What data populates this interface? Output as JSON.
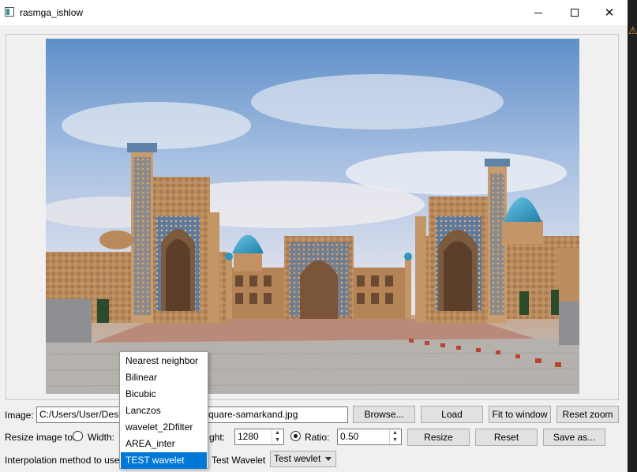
{
  "window": {
    "title": "rasmga_ishlow",
    "minimize_symbol": "—",
    "maximize_symbol": "☐",
    "close_symbol": "✕"
  },
  "image_row": {
    "label": "Image:",
    "path_left": "C:/Users/User/Deskto",
    "path_right": "square-samarkand.jpg",
    "browse_label": "Browse...",
    "load_label": "Load",
    "fit_label": "Fit to window",
    "reset_zoom_label": "Reset zoom"
  },
  "resize_row": {
    "label": "Resize image to:",
    "width_label": "Width:",
    "height_label_visible": "ght:",
    "height_value": "1280",
    "ratio_label": "Ratio:",
    "ratio_value": "0.50",
    "resize_label": "Resize",
    "reset_label": "Reset",
    "save_label": "Save as..."
  },
  "interp_row": {
    "label": "Interpolation method to use:",
    "test_wavelet_label": "Test Wavelet",
    "test_wavelet_combo": "Test wevlet"
  },
  "dropdown": {
    "options": [
      "Nearest neighbor",
      "Bilinear",
      "Bicubic",
      "Lanczos",
      "wavelet_2Dfilter",
      "AREA_inter",
      "TEST wavelet"
    ],
    "selected": "TEST wavelet"
  },
  "colors": {
    "selection": "#0078d7",
    "dome": "#3fa7c9",
    "sky": "#b9cbe3",
    "brick": "#b78a5e"
  },
  "icons": {
    "app": "app-window-icon",
    "warning": "warning-icon"
  },
  "warning_glyph": "⚠"
}
